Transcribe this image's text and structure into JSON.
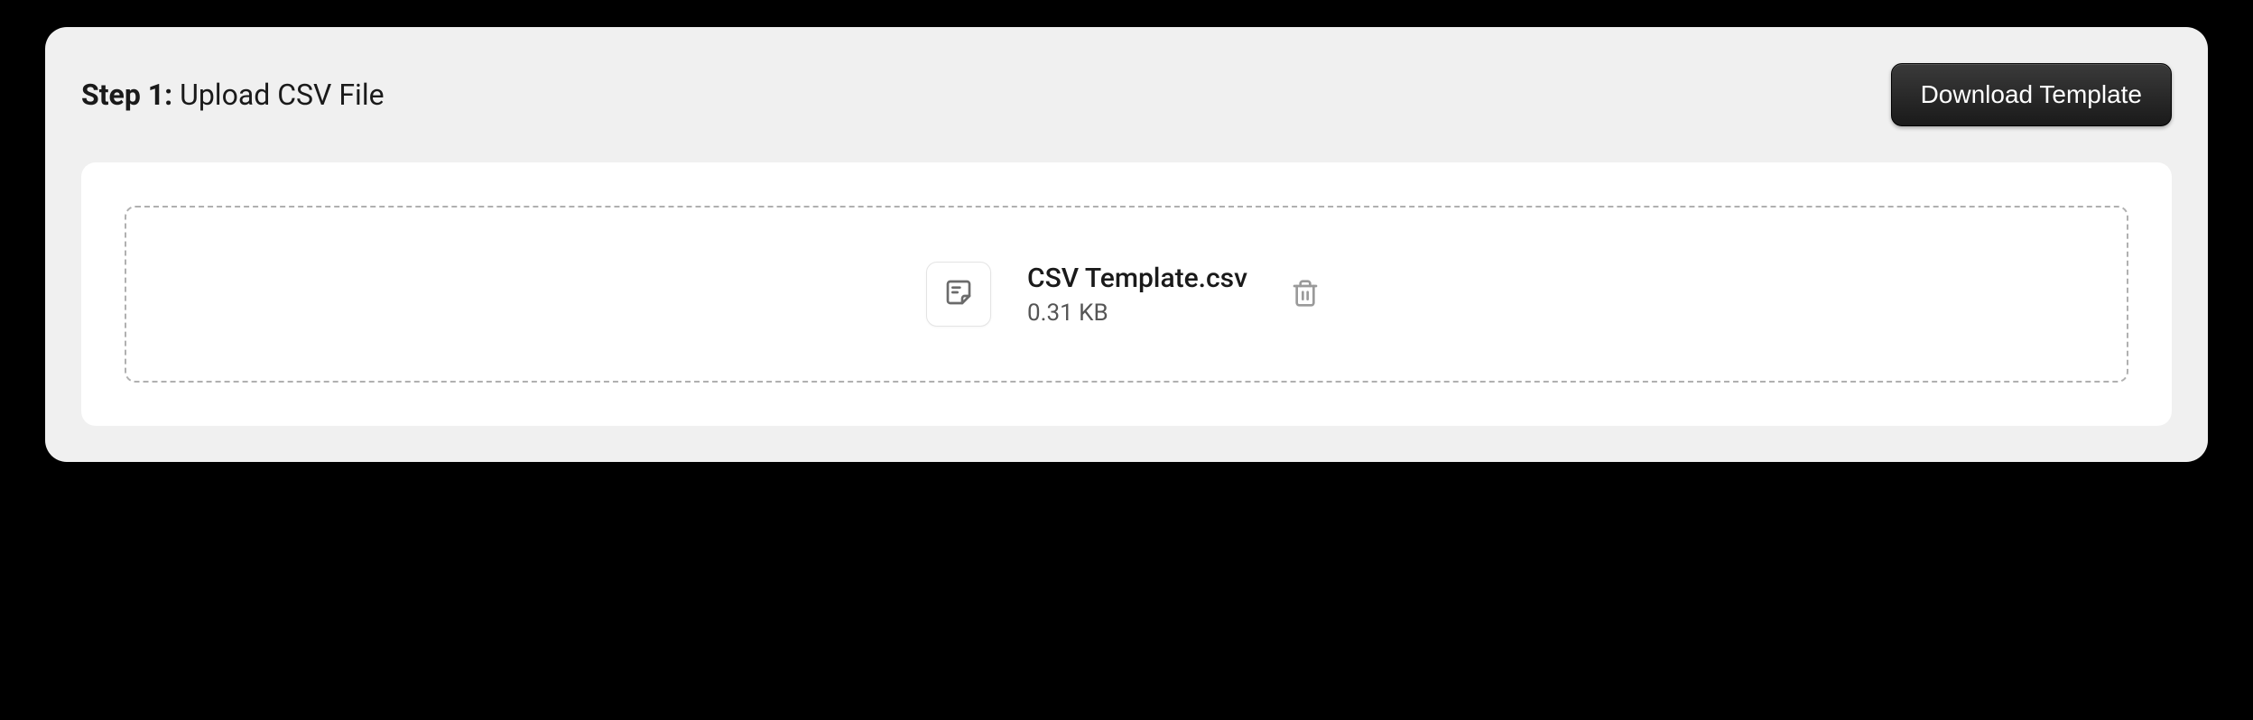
{
  "header": {
    "step_label": "Step 1:",
    "title": "Upload CSV File",
    "download_button": "Download Template"
  },
  "file": {
    "name": "CSV Template.csv",
    "size": "0.31 KB"
  }
}
